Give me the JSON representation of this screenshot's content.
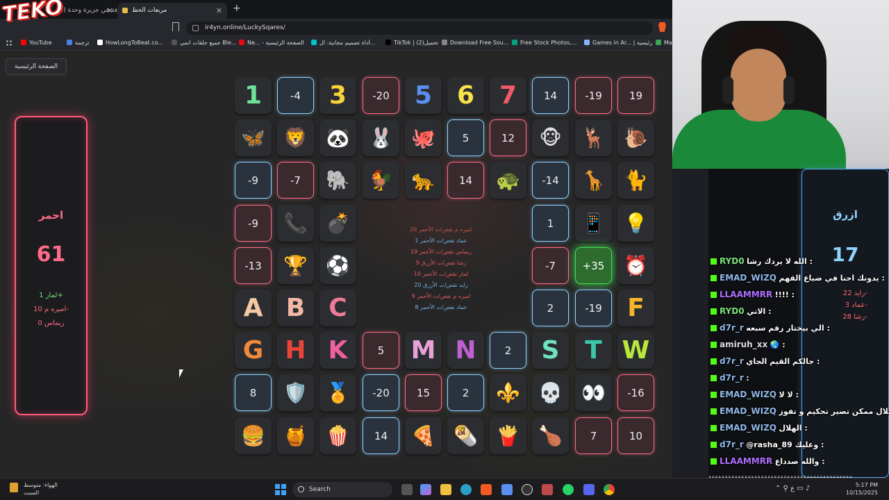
{
  "browser": {
    "tabs": [
      {
        "label": "(5) كل الأغرفة في جزيرة وحدة"
      },
      {
        "label": "مربعات الحظ"
      }
    ],
    "url": "ir4yn.online/LuckySqares/",
    "bookmarks": [
      {
        "label": "YouTube",
        "color": "#ff0000"
      },
      {
        "label": "ترجمة",
        "color": "#4a7fe8"
      },
      {
        "label": "HowLongToBeat.co...",
        "color": "#ffffff"
      },
      {
        "label": "جميع حلقات انمي Ble...",
        "color": "#555555"
      },
      {
        "label": "Ne... - الصفحة الرئيسية",
        "color": "#e50914"
      },
      {
        "label": "أداة تصميم مجانية: ال...",
        "color": "#00c4cc"
      },
      {
        "label": "TikTok | تحميل(2)",
        "color": "#000000"
      },
      {
        "label": "Download Free Sou...",
        "color": "#888888"
      },
      {
        "label": "Free Stock Photos,...",
        "color": "#05a081"
      },
      {
        "label": "Games in Ar... | رئيسية",
        "color": "#8ab4f8"
      },
      {
        "label": "Ma",
        "color": "#34a853"
      }
    ]
  },
  "logo_text": "TEKO",
  "page": {
    "home_label": "الصفحة الرئيسية",
    "red_team": {
      "name": "احمر",
      "score": "61",
      "players": [
        {
          "text": "لمار 1+",
          "color": "#7be07b"
        },
        {
          "text": "اميره م 10-",
          "color": "#ff6b6b"
        },
        {
          "text": "ريماس 0",
          "color": "#ff6b8a"
        }
      ]
    },
    "blue_team": {
      "name": "ازرق",
      "score": "17",
      "players": [
        {
          "text": "رايد 22-",
          "color": "#ff6b6b"
        },
        {
          "text": "عماد 3-",
          "color": "#ff6b6b"
        },
        {
          "text": "رشا 28-",
          "color": "#ff6b6b"
        }
      ]
    },
    "board": [
      [
        {
          "t": "1",
          "s": "letter",
          "c": "#6fe29a"
        },
        {
          "t": "-4",
          "s": "blue"
        },
        {
          "t": "3",
          "s": "letter",
          "c": "#f7d23a"
        },
        {
          "t": "-20",
          "s": "red"
        },
        {
          "t": "5",
          "s": "letter",
          "c": "#5a8ff0"
        },
        {
          "t": "6",
          "s": "letter",
          "c": "#f7e24a"
        },
        {
          "t": "7",
          "s": "letter",
          "c": "#f05a6a"
        },
        {
          "t": "14",
          "s": "blue"
        },
        {
          "t": "-19",
          "s": "red"
        },
        {
          "t": "19",
          "s": "red"
        }
      ],
      [
        {
          "t": "🦋",
          "s": "emoji"
        },
        {
          "t": "🦁",
          "s": "emoji"
        },
        {
          "t": "🐼",
          "s": "emoji"
        },
        {
          "t": "🐰",
          "s": "emoji"
        },
        {
          "t": "🐙",
          "s": "emoji"
        },
        {
          "t": "5",
          "s": "blue"
        },
        {
          "t": "12",
          "s": "red"
        },
        {
          "t": "🐵",
          "s": "emoji"
        },
        {
          "t": "🦌",
          "s": "emoji"
        },
        {
          "t": "🐌",
          "s": "emoji"
        }
      ],
      [
        {
          "t": "-9",
          "s": "blue"
        },
        {
          "t": "-7",
          "s": "red"
        },
        {
          "t": "🐘",
          "s": "emoji"
        },
        {
          "t": "🐓",
          "s": "emoji"
        },
        {
          "t": "🐆",
          "s": "emoji"
        },
        {
          "t": "14",
          "s": "red"
        },
        {
          "t": "🐢",
          "s": "emoji"
        },
        {
          "t": "-14",
          "s": "blue"
        },
        {
          "t": "🦒",
          "s": "emoji"
        },
        {
          "t": "🐈",
          "s": "emoji"
        }
      ],
      [
        {
          "t": "-9",
          "s": "red"
        },
        {
          "t": "📞",
          "s": "emoji"
        },
        {
          "t": "💣",
          "s": "emoji"
        },
        null,
        null,
        null,
        null,
        {
          "t": "1",
          "s": "blue"
        },
        {
          "t": "📱",
          "s": "emoji"
        },
        {
          "t": "💡",
          "s": "emoji"
        }
      ],
      [
        {
          "t": "-13",
          "s": "red"
        },
        {
          "t": "🏆",
          "s": "emoji"
        },
        {
          "t": "⚽",
          "s": "emoji"
        },
        null,
        null,
        null,
        null,
        {
          "t": "-7",
          "s": "red"
        },
        {
          "t": "+35",
          "s": "green"
        },
        {
          "t": "⏰",
          "s": "emoji"
        }
      ],
      [
        {
          "t": "A",
          "s": "letter",
          "c": "#f3c9a4"
        },
        {
          "t": "B",
          "s": "letter",
          "c": "#f3b8a4"
        },
        {
          "t": "C",
          "s": "letter",
          "c": "#f07a9a"
        },
        null,
        null,
        null,
        null,
        {
          "t": "2",
          "s": "blue"
        },
        {
          "t": "-19",
          "s": "blue"
        },
        {
          "t": "F",
          "s": "letter",
          "c": "#f7b52a"
        }
      ],
      [
        {
          "t": "G",
          "s": "letter",
          "c": "#f08a3a"
        },
        {
          "t": "H",
          "s": "letter",
          "c": "#e8443a"
        },
        {
          "t": "K",
          "s": "letter",
          "c": "#f060a0"
        },
        {
          "t": "5",
          "s": "red"
        },
        {
          "t": "M",
          "s": "letter",
          "c": "#e8a0d8"
        },
        {
          "t": "N",
          "s": "letter",
          "c": "#c060d0"
        },
        {
          "t": "2",
          "s": "blue"
        },
        {
          "t": "S",
          "s": "letter",
          "c": "#6fe2c0"
        },
        {
          "t": "T",
          "s": "letter",
          "c": "#3ac8a8"
        },
        {
          "t": "W",
          "s": "letter",
          "c": "#b8e83a"
        }
      ],
      [
        {
          "t": "8",
          "s": "blue"
        },
        {
          "t": "🛡️",
          "s": "emoji"
        },
        {
          "t": "🏅",
          "s": "emoji"
        },
        {
          "t": "-20",
          "s": "blue"
        },
        {
          "t": "15",
          "s": "red"
        },
        {
          "t": "2",
          "s": "blue"
        },
        {
          "t": "⚜️",
          "s": "emoji"
        },
        {
          "t": "💀",
          "s": "emoji"
        },
        {
          "t": "👀",
          "s": "emoji"
        },
        {
          "t": "-16",
          "s": "red"
        }
      ],
      [
        {
          "t": "🍔",
          "s": "emoji"
        },
        {
          "t": "🍯",
          "s": "emoji"
        },
        {
          "t": "🍿",
          "s": "emoji"
        },
        {
          "t": "14",
          "s": "blue"
        },
        {
          "t": "🍕",
          "s": "emoji"
        },
        {
          "t": "🌯",
          "s": "emoji"
        },
        {
          "t": "🍟",
          "s": "emoji"
        },
        {
          "t": "🍗",
          "s": "emoji"
        },
        {
          "t": "7",
          "s": "red"
        },
        {
          "t": "10",
          "s": "red"
        }
      ]
    ],
    "log": [
      {
        "text": "اميره م نقص/ت الأحمر 20",
        "color": "#c0554a"
      },
      {
        "text": "عماد نقص/ت الأحمر 1",
        "color": "#6fb0e8"
      },
      {
        "text": "ريماس نقص/ت الأحمر 19",
        "color": "#e05a5a"
      },
      {
        "text": "رشا نقص/ت الأزرق 9",
        "color": "#e05a5a"
      },
      {
        "text": "لمار نقص/ت الأحمر 16",
        "color": "#e05a5a"
      },
      {
        "text": "رايد نقص/ت الأزرق 20",
        "color": "#6fb0e8"
      },
      {
        "text": "اميره م نقص/ت الأحمر 9",
        "color": "#e05a5a"
      },
      {
        "text": "عماد نقص/ت الأحمر 8",
        "color": "#6fb0e8"
      }
    ]
  },
  "chat": {
    "messages": [
      {
        "user": "RYD0",
        "color": "#7be07b",
        "text": "الله لا يردك رشا :"
      },
      {
        "user": "EMAD_WIZQ",
        "color": "#8fb8e8",
        "text": "يدونك احنا في ضياع القهم :"
      },
      {
        "user": "LLAAMMRR",
        "color": "#b070ff",
        "text": "!!!! :"
      },
      {
        "user": "RYD0",
        "color": "#7be07b",
        "text": "الاتي :"
      },
      {
        "user": "d7r_r",
        "color": "#8fb8e8",
        "text": "الي بيختار رقم سبعه :"
      },
      {
        "user": "amiruh_xx",
        "color": "#dddddd",
        "text": "🌏 :"
      },
      {
        "user": "d7r_r",
        "color": "#8fb8e8",
        "text": "جالكم القيم الجاي :"
      },
      {
        "user": "d7r_r",
        "color": "#8fb8e8",
        "text": ":"
      },
      {
        "user": "EMAD_WIZQ",
        "color": "#8fb8e8",
        "text": "لا لا :"
      },
      {
        "user": "EMAD_WIZQ",
        "color": "#8fb8e8",
        "text": "الهلال ممكن تصير تحكيم و تفوز :"
      },
      {
        "user": "EMAD_WIZQ",
        "color": "#8fb8e8",
        "text": "الهلال :"
      },
      {
        "user": "d7r_r",
        "color": "#8fb8e8",
        "text": "@rasha_89 وعليك :"
      },
      {
        "user": "LLAAMMRR",
        "color": "#b070ff",
        "text": "والله صدداع :"
      }
    ],
    "hash_line": "ةةةةةةةةةةةةةةةةةةةةةةةةةةةةةةةةةةةةةةةةةةةة"
  },
  "taskbar": {
    "weather_line1": "الهواء: متوسط",
    "weather_line2": "السبت",
    "search_label": "Search",
    "time": "5:17 PM",
    "date": "10/15/2025",
    "lang": "ع"
  }
}
